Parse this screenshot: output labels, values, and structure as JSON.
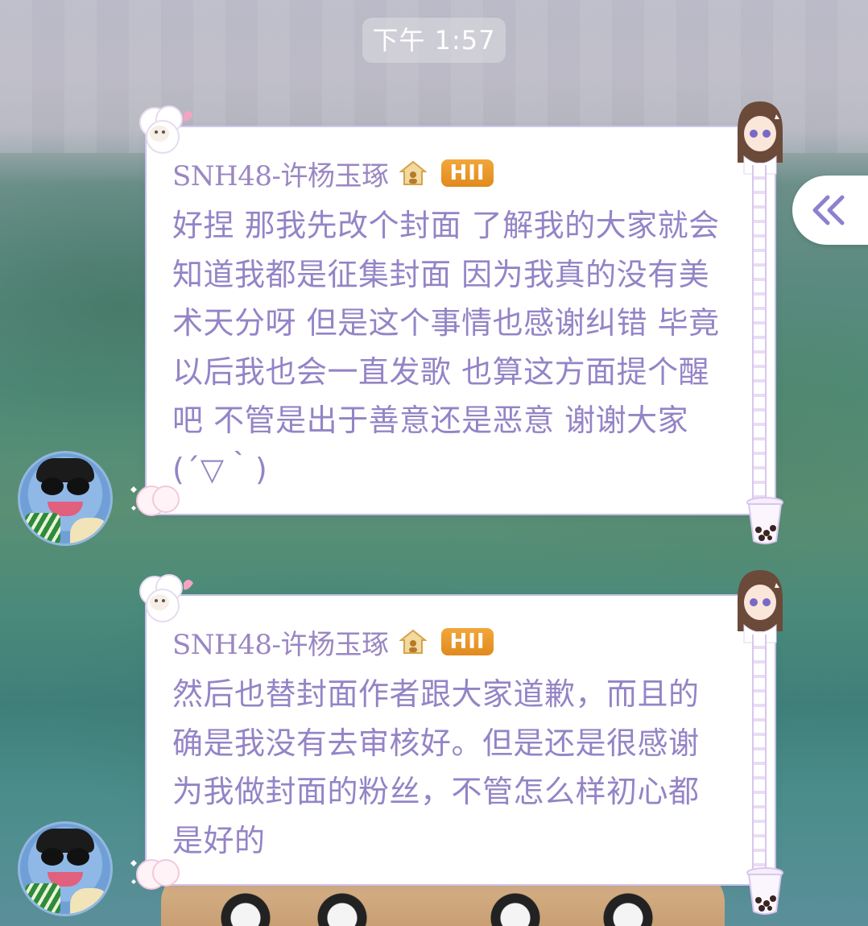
{
  "status": {
    "time": "下午 1:57"
  },
  "side_panel": {
    "collapse_icon": "double-chevron-left-icon"
  },
  "messages": [
    {
      "sender_name": "SNH48-许杨玉琢",
      "badge": "HII",
      "house_icon": "house-icon",
      "text": "好捏 那我先改个封面 了解我的大家就会知道我都是征集封面 因为我真的没有美术天分呀 但是这个事情也感谢纠错 毕竟以后我也会一直发歌 也算这方面提个醒吧 不管是出于善意还是恶意 谢谢大家 (´▽｀)"
    },
    {
      "sender_name": "SNH48-许杨玉琢",
      "badge": "HII",
      "house_icon": "house-icon",
      "text": "然后也替封面作者跟大家道歉，而且的确是我没有去审核好。但是还是很感谢为我做封面的粉丝，不管怎么样初心都是好的"
    }
  ],
  "colors": {
    "bubble_text": "#9484c6",
    "sender_name": "#9a87c2",
    "badge": "#e8931f"
  }
}
